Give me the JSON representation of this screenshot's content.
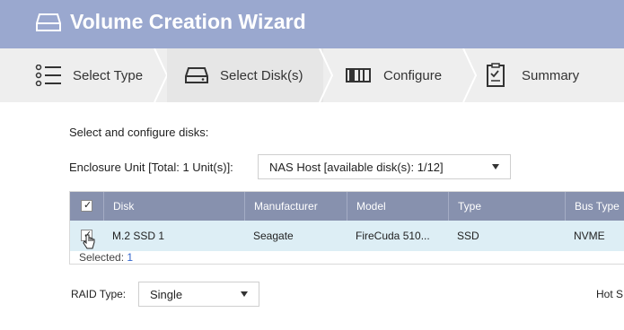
{
  "window": {
    "title": "Volume Creation Wizard",
    "icon": "drive-icon"
  },
  "steps": [
    {
      "label": "Select Type",
      "icon": "list-icon",
      "active": false
    },
    {
      "label": "Select Disk(s)",
      "icon": "disk-icon",
      "active": true
    },
    {
      "label": "Configure",
      "icon": "configure-icon",
      "active": false
    },
    {
      "label": "Summary",
      "icon": "summary-icon",
      "active": false
    }
  ],
  "main": {
    "section_label": "Select and configure disks:",
    "enclosure": {
      "label": "Enclosure Unit [Total: 1 Unit(s)]:",
      "value": "NAS Host [available disk(s): 1/12]"
    },
    "table": {
      "columns": [
        "Disk",
        "Manufacturer",
        "Model",
        "Type",
        "Bus Type"
      ],
      "rows": [
        {
          "checked": true,
          "disk": "M.2 SSD 1",
          "manufacturer": "Seagate",
          "model": "FireCuda 510...",
          "type": "SSD",
          "bus": "NVME"
        }
      ],
      "selected_label": "Selected:",
      "selected_count": "1"
    },
    "raid": {
      "label": "RAID Type:",
      "value": "Single"
    },
    "hot_spare_label": "Hot S"
  },
  "colors": {
    "titlebar": "#9aa8cf",
    "table_header": "#8791ae",
    "selected_row": "#ddeef5"
  }
}
